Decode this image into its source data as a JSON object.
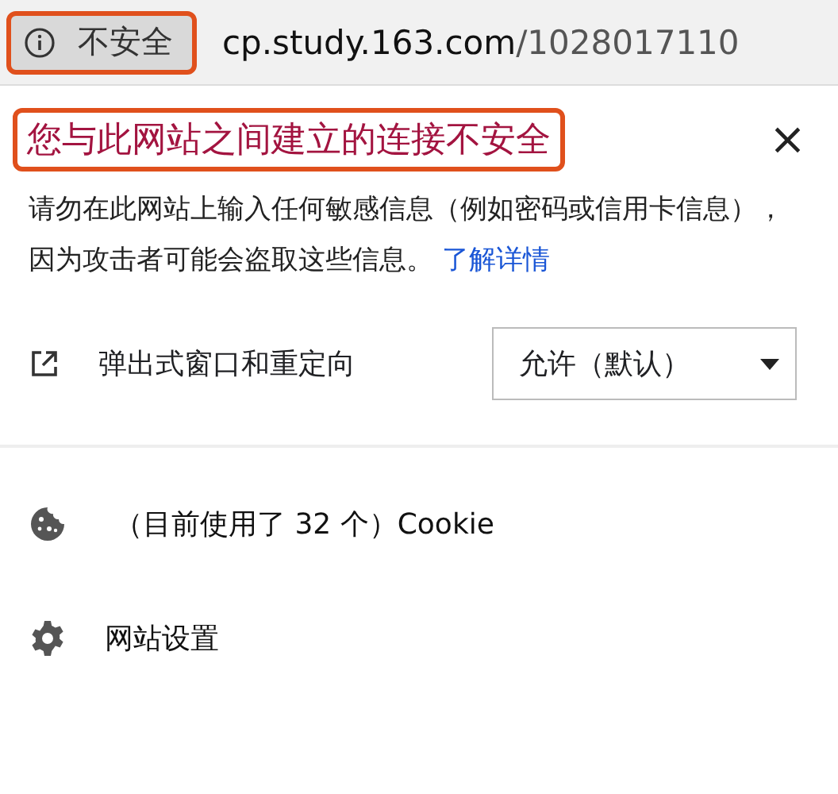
{
  "address_bar": {
    "security_chip": {
      "label": "不安全",
      "highlighted": true
    },
    "url_host": "cp.study.163.com",
    "url_path": "/1028017110"
  },
  "popup": {
    "heading": {
      "text": "您与此网站之间建立的连接不安全",
      "highlighted": true
    },
    "close": "×",
    "description": "请勿在此网站上输入任何敏感信息（例如密码或信用卡信息），因为攻击者可能会盗取这些信息。",
    "learn_more": "了解详情",
    "permissions": [
      {
        "kind": "popup",
        "label": "弹出式窗口和重定向",
        "value": "允许（默认）"
      }
    ],
    "links": [
      {
        "kind": "cookie",
        "label": "（目前使用了 32 个）Cookie"
      },
      {
        "kind": "settings",
        "label": "网站设置"
      }
    ]
  }
}
